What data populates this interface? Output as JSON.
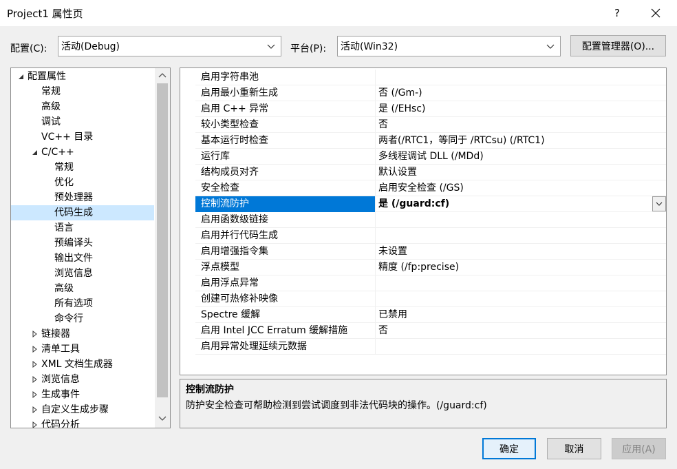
{
  "window": {
    "title": "Project1 属性页",
    "help_glyph": "?"
  },
  "config_bar": {
    "config_label": "配置(C):",
    "config_value": "活动(Debug)",
    "platform_label": "平台(P):",
    "platform_value": "活动(Win32)",
    "manager_button": "配置管理器(O)..."
  },
  "tree": {
    "items": [
      {
        "label": "配置属性",
        "level": 0,
        "expand": "open"
      },
      {
        "label": "常规",
        "level": 1,
        "expand": ""
      },
      {
        "label": "高级",
        "level": 1,
        "expand": ""
      },
      {
        "label": "调试",
        "level": 1,
        "expand": ""
      },
      {
        "label": "VC++ 目录",
        "level": 1,
        "expand": ""
      },
      {
        "label": "C/C++",
        "level": 1,
        "expand": "open"
      },
      {
        "label": "常规",
        "level": 2,
        "expand": ""
      },
      {
        "label": "优化",
        "level": 2,
        "expand": ""
      },
      {
        "label": "预处理器",
        "level": 2,
        "expand": ""
      },
      {
        "label": "代码生成",
        "level": 2,
        "expand": "",
        "selected": true
      },
      {
        "label": "语言",
        "level": 2,
        "expand": ""
      },
      {
        "label": "预编译头",
        "level": 2,
        "expand": ""
      },
      {
        "label": "输出文件",
        "level": 2,
        "expand": ""
      },
      {
        "label": "浏览信息",
        "level": 2,
        "expand": ""
      },
      {
        "label": "高级",
        "level": 2,
        "expand": ""
      },
      {
        "label": "所有选项",
        "level": 2,
        "expand": ""
      },
      {
        "label": "命令行",
        "level": 2,
        "expand": ""
      },
      {
        "label": "链接器",
        "level": 1,
        "expand": "closed"
      },
      {
        "label": "清单工具",
        "level": 1,
        "expand": "closed"
      },
      {
        "label": "XML 文档生成器",
        "level": 1,
        "expand": "closed"
      },
      {
        "label": "浏览信息",
        "level": 1,
        "expand": "closed"
      },
      {
        "label": "生成事件",
        "level": 1,
        "expand": "closed"
      },
      {
        "label": "自定义生成步骤",
        "level": 1,
        "expand": "closed"
      },
      {
        "label": "代码分析",
        "level": 1,
        "expand": "closed"
      }
    ]
  },
  "properties": [
    {
      "name": "启用字符串池",
      "value": ""
    },
    {
      "name": "启用最小重新生成",
      "value": "否 (/Gm-)"
    },
    {
      "name": "启用 C++ 异常",
      "value": "是 (/EHsc)"
    },
    {
      "name": "较小类型检查",
      "value": "否"
    },
    {
      "name": "基本运行时检查",
      "value": "两者(/RTC1，等同于 /RTCsu) (/RTC1)"
    },
    {
      "name": "运行库",
      "value": "多线程调试 DLL (/MDd)"
    },
    {
      "name": "结构成员对齐",
      "value": "默认设置"
    },
    {
      "name": "安全检查",
      "value": "启用安全检查 (/GS)"
    },
    {
      "name": "控制流防护",
      "value": "是 (/guard:cf)",
      "selected": true
    },
    {
      "name": "启用函数级链接",
      "value": ""
    },
    {
      "name": "启用并行代码生成",
      "value": ""
    },
    {
      "name": "启用增强指令集",
      "value": "未设置"
    },
    {
      "name": "浮点模型",
      "value": "精度 (/fp:precise)"
    },
    {
      "name": "启用浮点异常",
      "value": ""
    },
    {
      "name": "创建可热修补映像",
      "value": ""
    },
    {
      "name": "Spectre 缓解",
      "value": "已禁用"
    },
    {
      "name": "启用 Intel JCC Erratum 缓解措施",
      "value": "否"
    },
    {
      "name": "启用异常处理延续元数据",
      "value": ""
    }
  ],
  "description": {
    "title": "控制流防护",
    "text": "防护安全检查可帮助检测到尝试调度到非法代码块的操作。(/guard:cf)"
  },
  "buttons": {
    "ok": "确定",
    "cancel": "取消",
    "apply": "应用(A)"
  },
  "colors": {
    "selection": "#0078d7",
    "tree_selection": "#cce8ff",
    "accent_border": "#0078d7"
  }
}
